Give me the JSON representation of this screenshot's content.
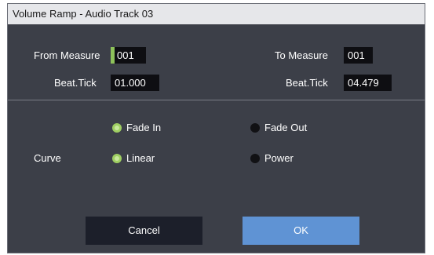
{
  "dialog": {
    "title": "Volume Ramp - Audio Track 03",
    "from_measure": {
      "label": "From Measure",
      "value": "001"
    },
    "to_measure": {
      "label": "To Measure",
      "value": "001"
    },
    "from_beat": {
      "label": "Beat.Tick",
      "value": "01.000"
    },
    "to_beat": {
      "label": "Beat.Tick",
      "value": "04.479"
    },
    "curve": {
      "label": "Curve",
      "options": [
        {
          "label": "Fade In",
          "selected": true
        },
        {
          "label": "Fade Out",
          "selected": false
        },
        {
          "label": "Linear",
          "selected": true
        },
        {
          "label": "Power",
          "selected": false
        }
      ]
    },
    "buttons": {
      "cancel": "Cancel",
      "ok": "OK"
    },
    "colors": {
      "accent": "#8ec25a",
      "ok_button": "#5f93d4",
      "panel": "#3c3f48"
    }
  }
}
